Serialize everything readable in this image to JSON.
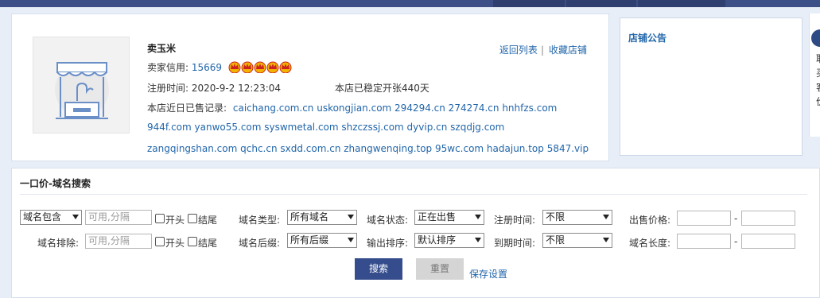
{
  "shop": {
    "name": "卖玉米",
    "credit_label": "卖家信用:",
    "credit_value": "15669",
    "reg_label": "注册时间:",
    "reg_time": "2020-9-2 12:23:04",
    "since_text": "本店已稳定开张440天",
    "sold_label": "本店近日已售记录:",
    "sold_line1": "caichang.com.cn uskongjian.com 294294.cn 274274.cn hnhfzs.com",
    "sold_line2": "944f.com yanwo55.com syswmetal.com shzczssj.com dyvip.cn szqdjg.com",
    "sold_line3": "zangqingshan.com qchc.cn sxdd.com.cn zhangwenqing.top 95wc.com hadajun.top 5847.vip",
    "back_link": "返回列表",
    "fav_link": "收藏店铺",
    "crown_color": "#f2b400"
  },
  "notice": {
    "title": "店铺公告"
  },
  "edge": {
    "glyphs": [
      "取",
      "买",
      "客",
      "价"
    ]
  },
  "search": {
    "title": "一口价-域名搜索",
    "contains_select": "域名包含",
    "contains_placeholder": "可用,分隔",
    "exclude_label": "域名排除:",
    "exclude_placeholder": "可用,分隔",
    "start_label": "开头",
    "end_label": "结尾",
    "type_label": "域名类型:",
    "type_value": "所有域名",
    "suffix_label": "域名后缀:",
    "suffix_value": "所有后缀",
    "status_label": "域名状态:",
    "status_value": "正在出售",
    "sort_label": "输出排序:",
    "sort_value": "默认排序",
    "regtime_label": "注册时间:",
    "regtime_value": "不限",
    "expire_label": "到期时间:",
    "expire_value": "不限",
    "price_label": "出售价格:",
    "length_label": "域名长度:",
    "dash": "-",
    "search_button": "搜索",
    "reset_button": "重置",
    "save_link": "保存设置"
  }
}
